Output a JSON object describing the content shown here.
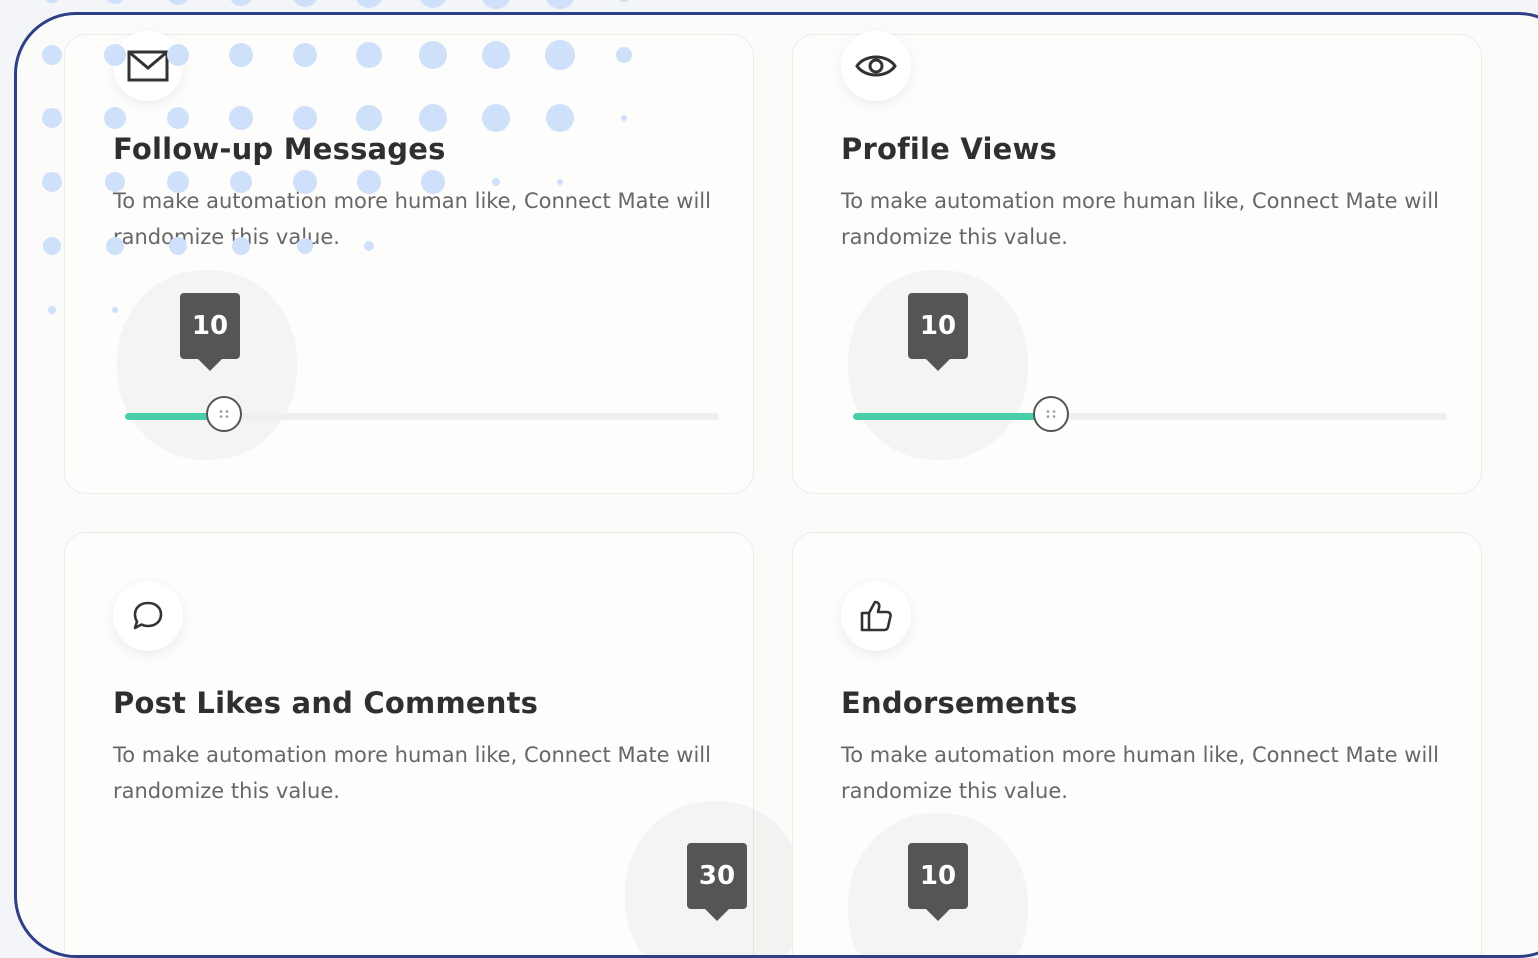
{
  "cards": [
    {
      "title": "Follow-up Messages",
      "description": "To make automation more human like, Connect Mate will randomize this value.",
      "icon": "envelope-icon",
      "slider": {
        "value": "10",
        "fill_fraction": 0.167
      }
    },
    {
      "title": "Profile Views",
      "description": "To make automation more human like, Connect Mate will randomize this value.",
      "icon": "eye-icon",
      "slider": {
        "value": "10",
        "fill_fraction": 0.333
      }
    },
    {
      "title": "Post Likes and Comments",
      "description": "To make automation more human like, Connect Mate will randomize this value.",
      "icon": "chat-bubble-icon",
      "slider": {
        "value": "30"
      }
    },
    {
      "title": "Endorsements",
      "description": "To make automation more human like, Connect Mate will randomize this value.",
      "icon": "thumbs-up-icon",
      "slider": {
        "value": "10"
      }
    }
  ],
  "colors": {
    "frame_border": "#2f3f86",
    "slider_fill": "#46cfa9",
    "tooltip": "#555555",
    "dots": "#cfe0fb"
  }
}
